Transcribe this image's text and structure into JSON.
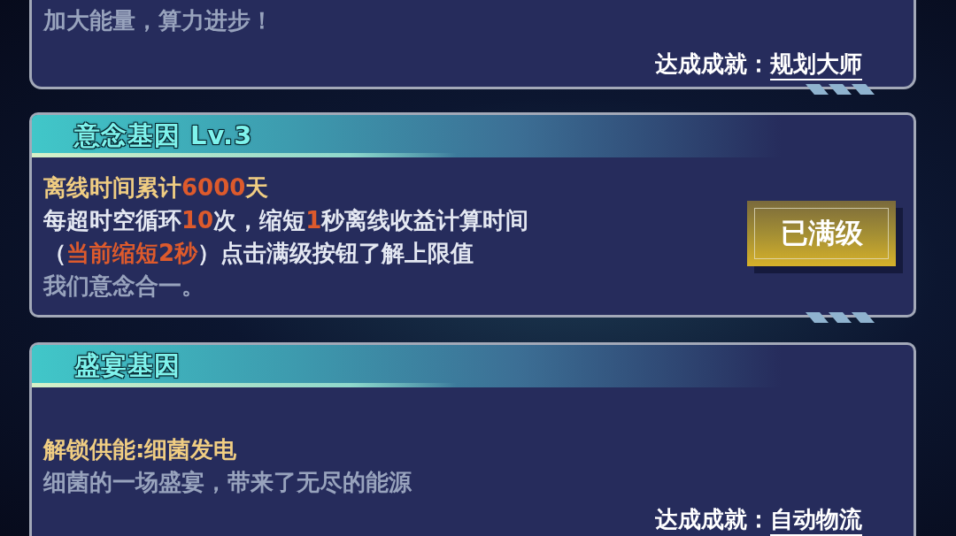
{
  "cards": [
    {
      "lines": [
        {
          "segments": [
            {
              "color": "#98a3bd",
              "text": "加大能量，算力进步！"
            }
          ]
        }
      ],
      "achievement": {
        "label": "达成成就：",
        "value": "规划大师"
      },
      "stripes": true
    },
    {
      "title": "意念基因 Lv.3",
      "lines": [
        {
          "segments": [
            {
              "color": "#f0cd82",
              "text": "离线时间累计"
            },
            {
              "color": "#dd5a2c",
              "text": "6000"
            },
            {
              "color": "#f0cd82",
              "text": "天"
            }
          ]
        },
        {
          "segments": [
            {
              "color": "#e4e8f2",
              "text": "每超时空循环"
            },
            {
              "color": "#dd5a2c",
              "text": "10"
            },
            {
              "color": "#e4e8f2",
              "text": "次，缩短"
            },
            {
              "color": "#dd5a2c",
              "text": "1"
            },
            {
              "color": "#e4e8f2",
              "text": "秒离线收益计算时间"
            }
          ]
        },
        {
          "segments": [
            {
              "color": "#e4e8f2",
              "text": "（"
            },
            {
              "color": "#dd5a2c",
              "text": "当前缩短2秒"
            },
            {
              "color": "#e4e8f2",
              "text": "）点击满级按钮了解上限值"
            }
          ]
        },
        {
          "segments": [
            {
              "color": "#98a3bd",
              "text": "我们意念合一。"
            }
          ]
        }
      ],
      "button": {
        "label": "已满级"
      },
      "stripes": true
    },
    {
      "title": "盛宴基因",
      "lines": [
        {
          "segments": [
            {
              "color": "#f0cd82",
              "text": "解锁供能:细菌发电"
            }
          ]
        },
        {
          "segments": [
            {
              "color": "#98a3bd",
              "text": "细菌的一场盛宴，带来了无尽的能源"
            }
          ]
        }
      ],
      "achievement": {
        "label": "达成成就：",
        "value": "自动物流"
      },
      "stripes": false
    }
  ]
}
